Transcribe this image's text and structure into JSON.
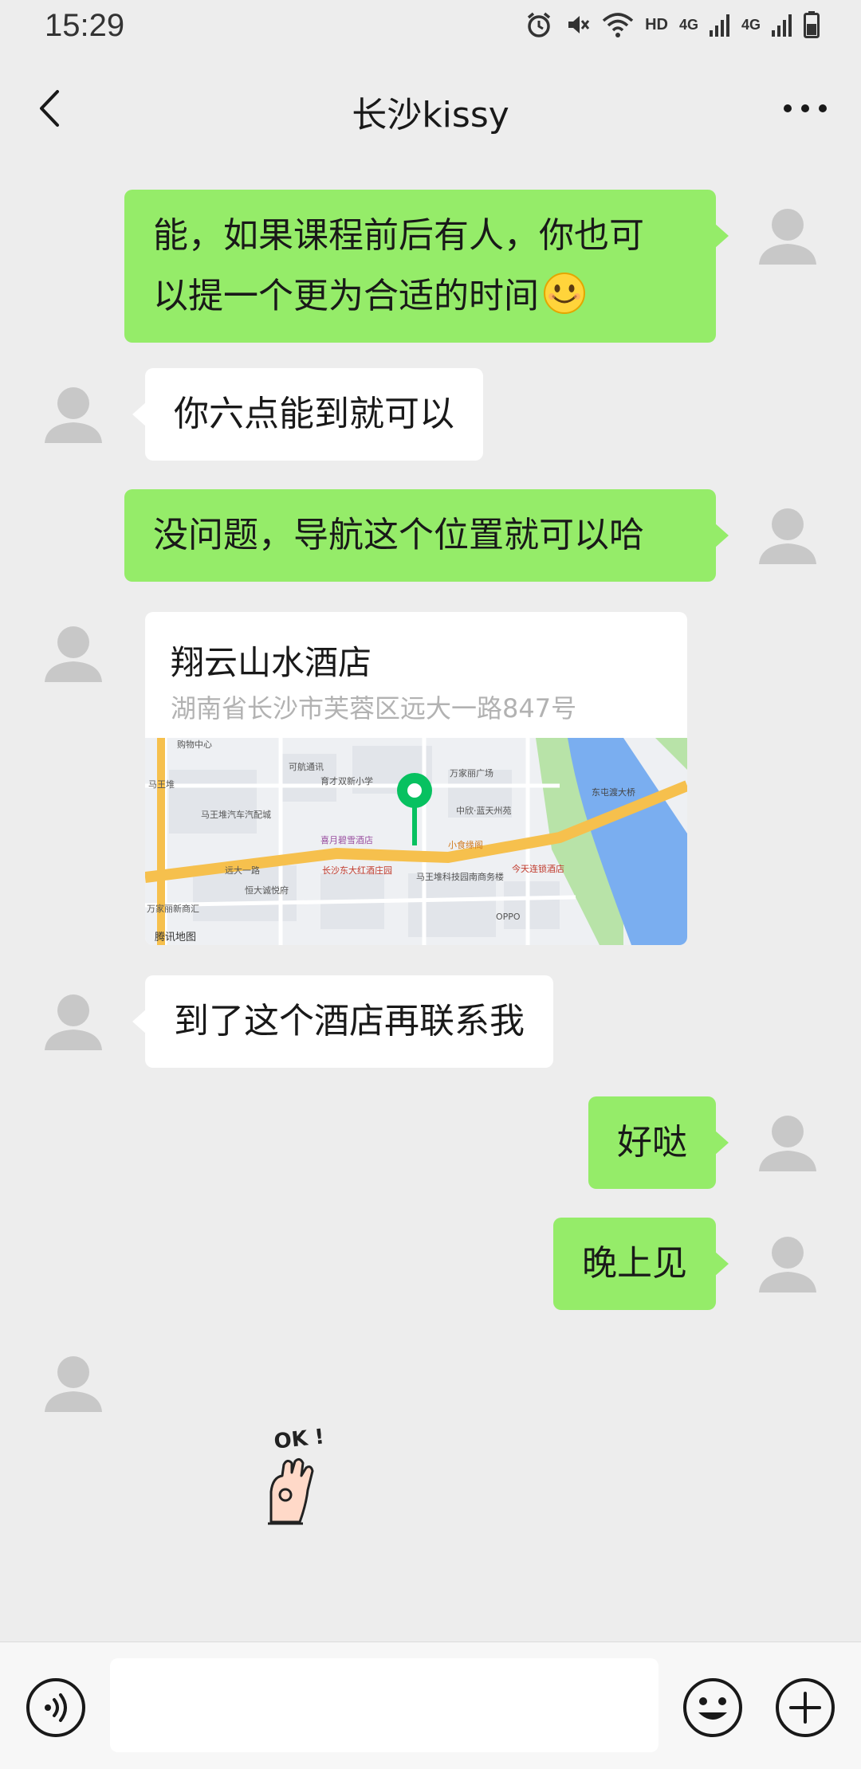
{
  "status_bar": {
    "time": "15:29",
    "hd": "HD",
    "network_1": "4G",
    "network_2": "4G"
  },
  "header": {
    "title": "长沙kissy",
    "back_icon": "chevron-left-icon",
    "more_icon": "more-dots-icon"
  },
  "messages": [
    {
      "from": "me",
      "text": "能，如果课程前后有人，你也可以提一个更为合适的时间",
      "line1": "能，如果课程前后有人，你也可",
      "line2": "以提一个更为合适的时间",
      "emoji": "smile-emoji"
    },
    {
      "from": "other",
      "text": "你六点能到就可以"
    },
    {
      "from": "me",
      "text": "没问题，导航这个位置就可以哈"
    },
    {
      "from": "other",
      "type": "location",
      "name": "翔云山水酒店",
      "address": "湖南省长沙市芙蓉区远大一路847号"
    },
    {
      "from": "other",
      "text": "到了这个酒店再联系我"
    },
    {
      "from": "me",
      "text": "好哒"
    },
    {
      "from": "me",
      "text": "晚上见"
    },
    {
      "from": "other",
      "type": "sticker",
      "sticker_text": "OK !"
    }
  ],
  "map_labels": {
    "poi_1": "万家丽广场",
    "poi_2": "喜月碧雪酒店",
    "poi_3": "长沙东大红酒庄园",
    "poi_4": "小食缘阁",
    "poi_5": "今天连锁酒店",
    "poi_6": "马王堆科技园南商务楼",
    "poi_7": "育才双新小学",
    "poi_8": "马王堆汽车汽配城",
    "poi_9": "恒大诚悦府",
    "poi_10": "万家丽新商汇",
    "poi_11": "可航通讯",
    "poi_12": "中欣·蓝天州苑",
    "poi_13": "购物中心",
    "poi_14": "马王堆",
    "road_1": "远大一路",
    "road_2": "东屯渡大桥",
    "brand": "OPPO",
    "provider": "腾讯地图"
  },
  "input_bar": {
    "placeholder": "",
    "voice_icon": "voice-icon",
    "emoji_icon": "emoji-icon",
    "plus_icon": "plus-icon"
  },
  "colors": {
    "background": "#ededed",
    "bubble_me": "#95ec69",
    "bubble_other": "#ffffff",
    "pin": "#07c160",
    "river": "#7aaef0",
    "road": "#f6c04d"
  }
}
